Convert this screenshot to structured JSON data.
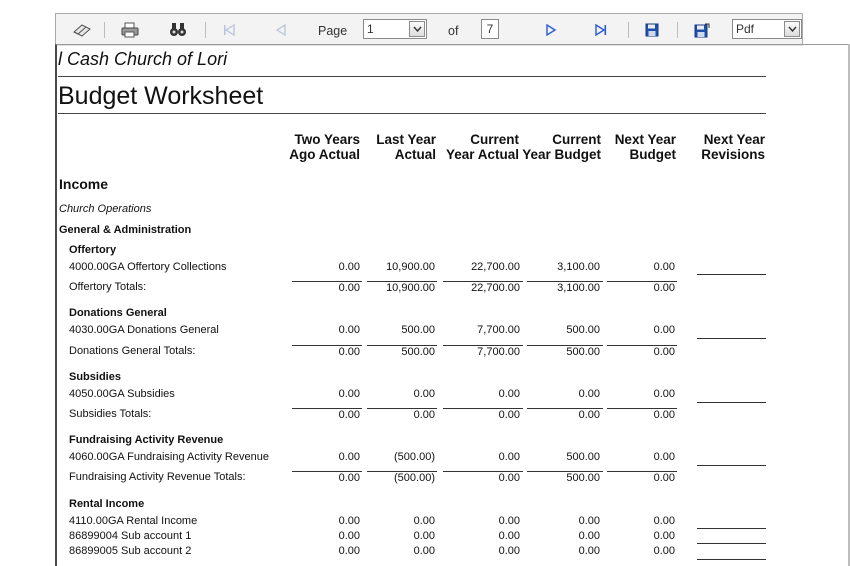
{
  "toolbar": {
    "page_label": "Page",
    "current_page": "1",
    "of_label": "of",
    "total_pages": "7",
    "format": "Pdf"
  },
  "report": {
    "church": "l Cash Church of Lori",
    "title": "Budget Worksheet",
    "columns": [
      [
        "Two Years",
        "Ago Actual"
      ],
      [
        "Last Year",
        "Actual"
      ],
      [
        "Current",
        "Year Actual"
      ],
      [
        "Current",
        "Year Budget"
      ],
      [
        "Next Year",
        "Budget"
      ],
      [
        "Next Year",
        "Revisions"
      ]
    ],
    "section": "Income",
    "subsection": "Church Operations",
    "group": "General & Administration",
    "blocks": [
      {
        "heading": "Offertory",
        "lines": [
          {
            "label": "4000.00GA  Offertory Collections",
            "values": [
              "0.00",
              "10,900.00",
              "22,700.00",
              "3,100.00",
              "0.00"
            ]
          }
        ],
        "total_label": "Offertory Totals:",
        "totals": [
          "0.00",
          "10,900.00",
          "22,700.00",
          "3,100.00",
          "0.00"
        ]
      },
      {
        "heading": "Donations  General",
        "lines": [
          {
            "label": "4030.00GA  Donations  General",
            "values": [
              "0.00",
              "500.00",
              "7,700.00",
              "500.00",
              "0.00"
            ]
          }
        ],
        "total_label": "Donations  General Totals:",
        "totals": [
          "0.00",
          "500.00",
          "7,700.00",
          "500.00",
          "0.00"
        ]
      },
      {
        "heading": "Subsidies",
        "lines": [
          {
            "label": "4050.00GA  Subsidies",
            "values": [
              "0.00",
              "0.00",
              "0.00",
              "0.00",
              "0.00"
            ]
          }
        ],
        "total_label": "Subsidies Totals:",
        "totals": [
          "0.00",
          "0.00",
          "0.00",
          "0.00",
          "0.00"
        ]
      },
      {
        "heading": "Fundraising Activity Revenue",
        "lines": [
          {
            "label": "4060.00GA  Fundraising Activity Revenue",
            "values": [
              "0.00",
              "(500.00)",
              "0.00",
              "500.00",
              "0.00"
            ]
          }
        ],
        "total_label": "Fundraising Activity Revenue Totals:",
        "totals": [
          "0.00",
          "(500.00)",
          "0.00",
          "500.00",
          "0.00"
        ]
      },
      {
        "heading": "Rental Income",
        "lines": [
          {
            "label": "4110.00GA  Rental Income",
            "values": [
              "0.00",
              "0.00",
              "0.00",
              "0.00",
              "0.00"
            ]
          },
          {
            "label": "86899004  Sub account 1",
            "values": [
              "0.00",
              "0.00",
              "0.00",
              "0.00",
              "0.00"
            ]
          },
          {
            "label": "86899005  Sub account 2",
            "values": [
              "0.00",
              "0.00",
              "0.00",
              "0.00",
              "0.00"
            ]
          }
        ]
      }
    ]
  }
}
